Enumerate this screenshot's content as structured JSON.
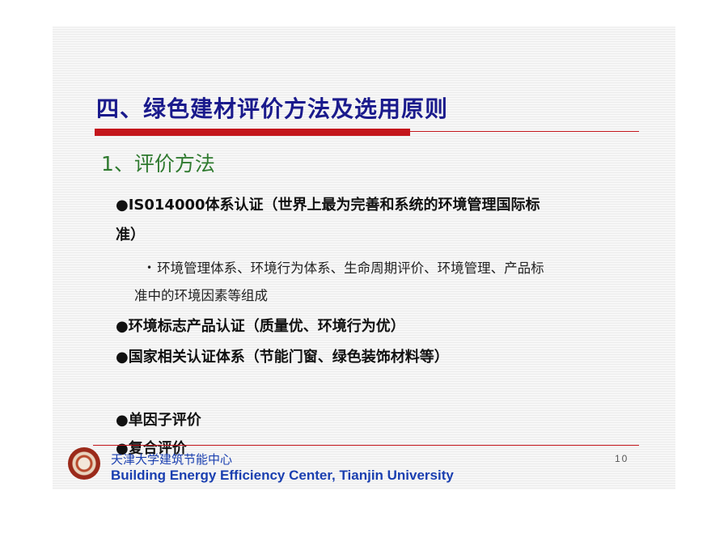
{
  "slide": {
    "title": "四、绿色建材评价方法及选用原则",
    "subtitle": "1、评价方法",
    "bullets": [
      {
        "marker": "●",
        "line1": "IS014000体系认证（世界上最为完善和系统的环境管理国际标",
        "line2": "准）"
      },
      {
        "marker": "•",
        "line1": "环境管理体系、环境行为体系、生命周期评价、环境管理、产品标",
        "line2": "准中的环境因素等组成"
      },
      {
        "marker": "●",
        "text": "环境标志产品认证（质量优、环境行为优）"
      },
      {
        "marker": "●",
        "text": "国家相关认证体系（节能门窗、绿色装饰材料等）"
      },
      {
        "marker": "●",
        "text": "单因子评价"
      },
      {
        "marker": "●",
        "text": "复合评价"
      }
    ],
    "footer": {
      "cn": "天津大学建筑节能中心",
      "en": "Building Energy Efficiency Center, Tianjin University",
      "page": "10"
    }
  },
  "colors": {
    "title": "#1a1a8c",
    "subtitle": "#2f7a2f",
    "accent_red": "#c4161c",
    "footer_blue": "#1a3fb0"
  }
}
